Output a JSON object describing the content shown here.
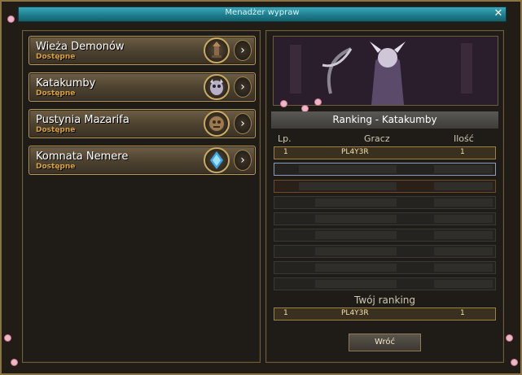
{
  "window": {
    "title": "Menadżer wypraw",
    "close_icon": "close-icon"
  },
  "dungeons": [
    {
      "name": "Wieża Demonów",
      "status": "Dostępne",
      "icon": "demon-tower-icon"
    },
    {
      "name": "Katakumby",
      "status": "Dostępne",
      "icon": "catacombs-icon"
    },
    {
      "name": "Pustynia Mazarifa",
      "status": "Dostępne",
      "icon": "desert-icon"
    },
    {
      "name": "Komnata Nemere",
      "status": "Dostępne",
      "icon": "nemere-icon"
    }
  ],
  "ranking": {
    "title": "Ranking - Katakumby",
    "headers": {
      "lp": "Lp.",
      "player": "Gracz",
      "count": "Ilość"
    },
    "rows": [
      {
        "lp": "1",
        "player": "PL4Y3R",
        "count": "1"
      }
    ],
    "your_ranking_label": "Twój ranking",
    "your_row": {
      "lp": "1",
      "player": "PL4Y3R",
      "count": "1"
    }
  },
  "buttons": {
    "back": "Wróć"
  },
  "colors": {
    "title_bar": "#1f7f8f",
    "frame": "#8a7444",
    "status": "#d9a33c"
  }
}
